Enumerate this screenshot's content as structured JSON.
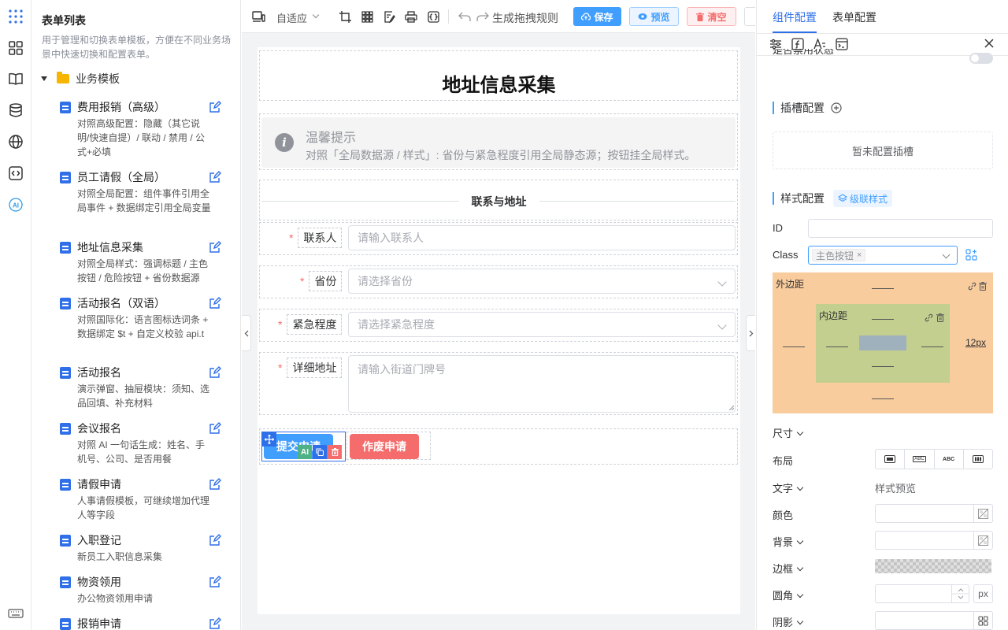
{
  "sidebar": {
    "title": "表单列表",
    "description": "用于管理和切换表单模板，方便在不同业务场景中快速切换和配置表单。",
    "folder": "业务模板",
    "items": [
      {
        "name": "费用报销（高级）",
        "desc": "对照高级配置：隐藏（其它说明/快速自提）/ 联动 / 禁用 / 公式+必填"
      },
      {
        "name": "员工请假（全局）",
        "desc": "对照全局配置：组件事件引用全局事件 + 数据绑定引用全局变量"
      },
      {
        "name": "地址信息采集",
        "desc": "对照全局样式：强调标题 / 主色按钮 / 危险按钮 + 省份数据源"
      },
      {
        "name": "活动报名（双语）",
        "desc": "对照国际化：语言图标选词条 + 数据绑定 $t + 自定义校验 api.t"
      },
      {
        "name": "活动报名",
        "desc": "演示弹窗、抽屉模块：须知、选品回填、补充材料"
      },
      {
        "name": "会议报名",
        "desc": "对照 AI 一句话生成：姓名、手机号、公司、是否用餐"
      },
      {
        "name": "请假申请",
        "desc": "人事请假模板，可继续增加代理人等字段"
      },
      {
        "name": "入职登记",
        "desc": "新员工入职信息采集"
      },
      {
        "name": "物资领用",
        "desc": "办公物资领用申请"
      },
      {
        "name": "报销申请",
        "desc": ""
      }
    ]
  },
  "toolbar": {
    "adapt": "自适应",
    "gen_rules": "生成拖拽规则",
    "save": "保存",
    "preview": "预览",
    "clear": "清空"
  },
  "form": {
    "title": "地址信息采集",
    "tip_title": "温馨提示",
    "tip_text": "对照「全局数据源 / 样式」: 省份与紧急程度引用全局静态源；按钮挂全局样式。",
    "section": "联系与地址",
    "fields": [
      {
        "label": "联系人",
        "placeholder": "请输入联系人"
      },
      {
        "label": "省份",
        "placeholder": "请选择省份"
      },
      {
        "label": "紧急程度",
        "placeholder": "请选择紧急程度"
      },
      {
        "label": "详细地址",
        "placeholder": "请输入街道门牌号"
      }
    ],
    "submit": "提交申请",
    "void": "作废申请",
    "ai_badge": "AI"
  },
  "panel": {
    "tab_component": "组件配置",
    "tab_form": "表单配置",
    "cut_label": "是否禁用状态",
    "slot_title": "插槽配置",
    "slot_empty": "暂未配置插槽",
    "style_title": "样式配置",
    "cascade": "级联样式",
    "id_label": "ID",
    "class_label": "Class",
    "class_tag": "主色按钮",
    "margin": "外边距",
    "padding": "内边距",
    "margin_right_value": "12px",
    "size": "尺寸",
    "layout": "布局",
    "text": "文字",
    "text_preview": "样式预览",
    "color": "颜色",
    "background": "背景",
    "border": "边框",
    "radius": "圆角",
    "radius_unit": "px",
    "shadow": "阴影",
    "layout_options": [
      "block",
      "ABC",
      "ABC",
      "flex"
    ]
  }
}
